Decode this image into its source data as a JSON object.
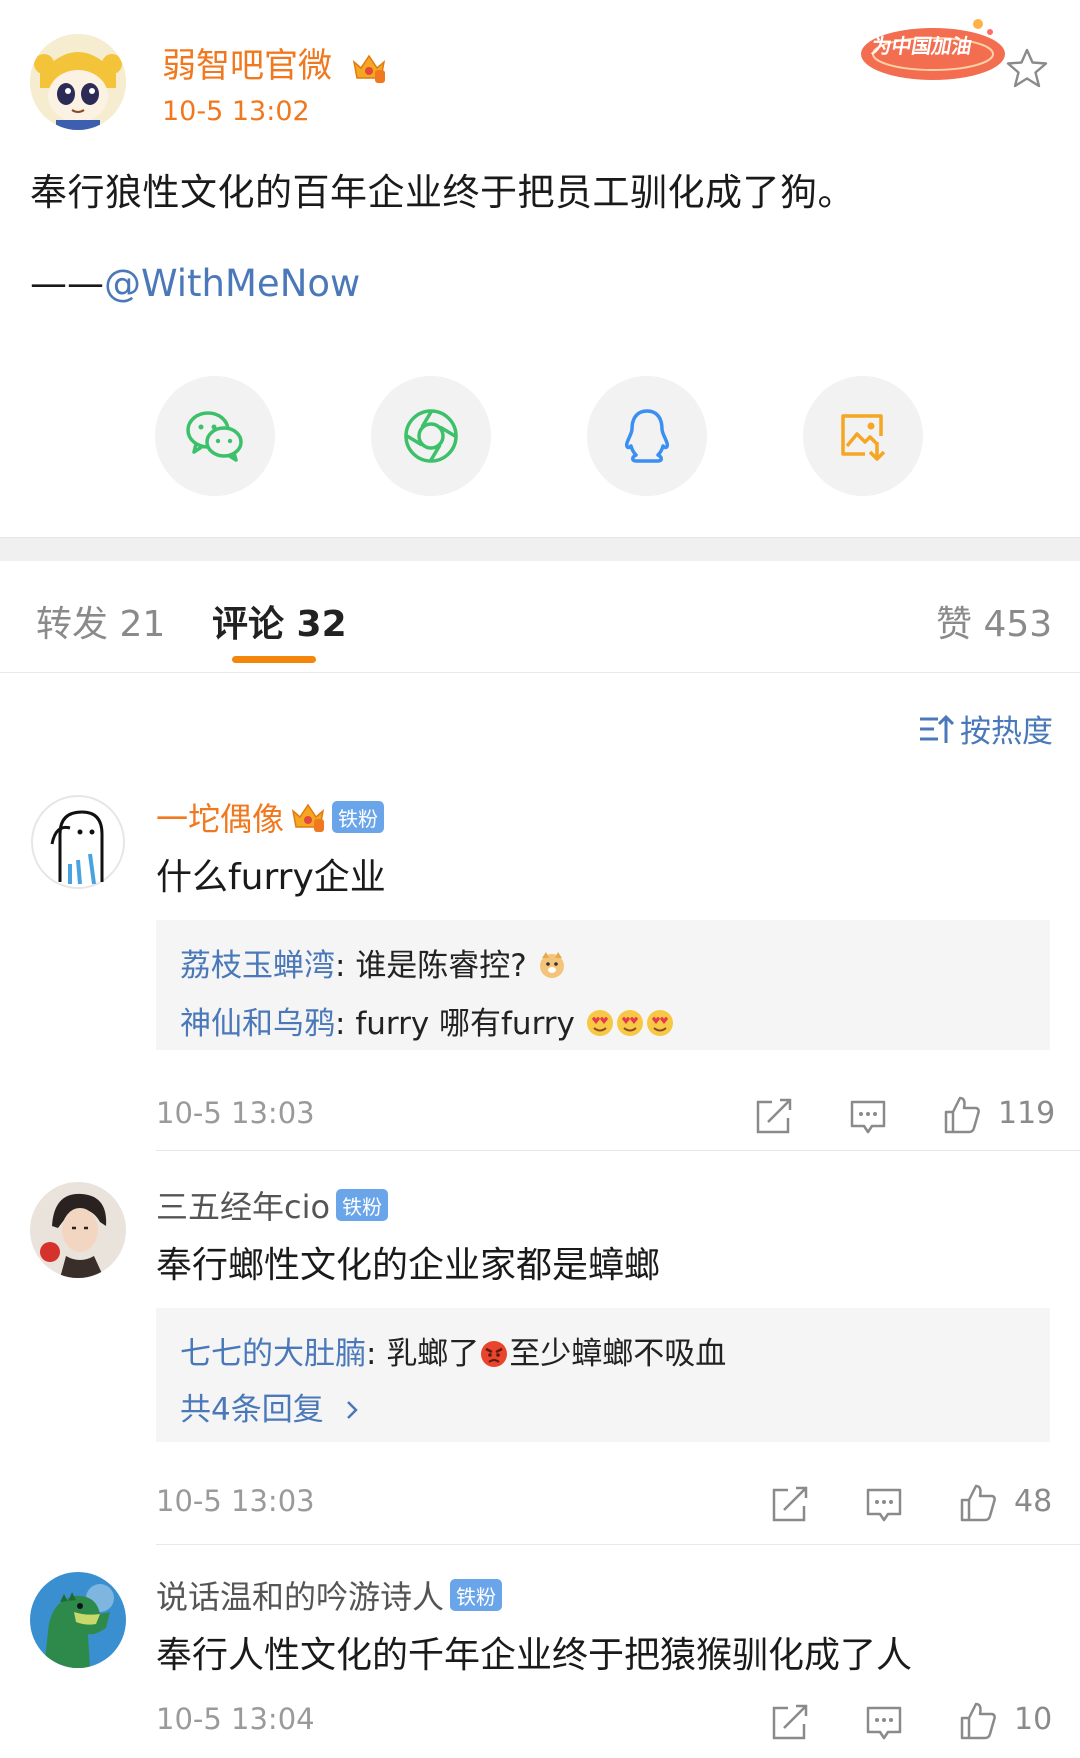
{
  "post": {
    "author": "弱智吧官微",
    "time": "10-5 13:02",
    "badge_text": "为中国加油",
    "text": "奉行狼性文化的百年企业终于把员工驯化成了狗。",
    "signature_prefix": "——",
    "signature_mention": "@WithMeNow",
    "share_buttons": [
      "wechat-icon",
      "moments-icon",
      "qq-icon",
      "save-image-icon"
    ]
  },
  "tabs": {
    "repost": "转发 21",
    "comments": "评论 32",
    "likes": "赞 453"
  },
  "sort": {
    "label": "按热度"
  },
  "comments": [
    {
      "name": "一坨偶像",
      "name_color": "#f0781e",
      "fan_badge": "铁粉",
      "text": "什么furry企业",
      "replies": [
        {
          "name": "荔枝玉蝉湾",
          "sep": ": ",
          "text": "谁是陈睿控?"
        },
        {
          "name": "神仙和乌鸦",
          "sep": ": ",
          "text": "furry 哪有furry"
        }
      ],
      "time": "10-5 13:03",
      "likes": "119"
    },
    {
      "name": "三五经年cio",
      "fan_badge": "铁粉",
      "text": "奉行螂性文化的企业家都是蟑螂",
      "replies": [
        {
          "name": "七七的大肚腩",
          "sep": ": ",
          "text_before": "乳螂了",
          "text_after": "至少蟑螂不吸血"
        }
      ],
      "more_replies": "共4条回复",
      "time": "10-5 13:03",
      "likes": "48"
    },
    {
      "name": "说话温和的吟游诗人",
      "fan_badge": "铁粉",
      "text": "奉行人性文化的千年企业终于把猿猴驯化成了人",
      "time": "10-5 13:04",
      "likes": "10"
    }
  ]
}
